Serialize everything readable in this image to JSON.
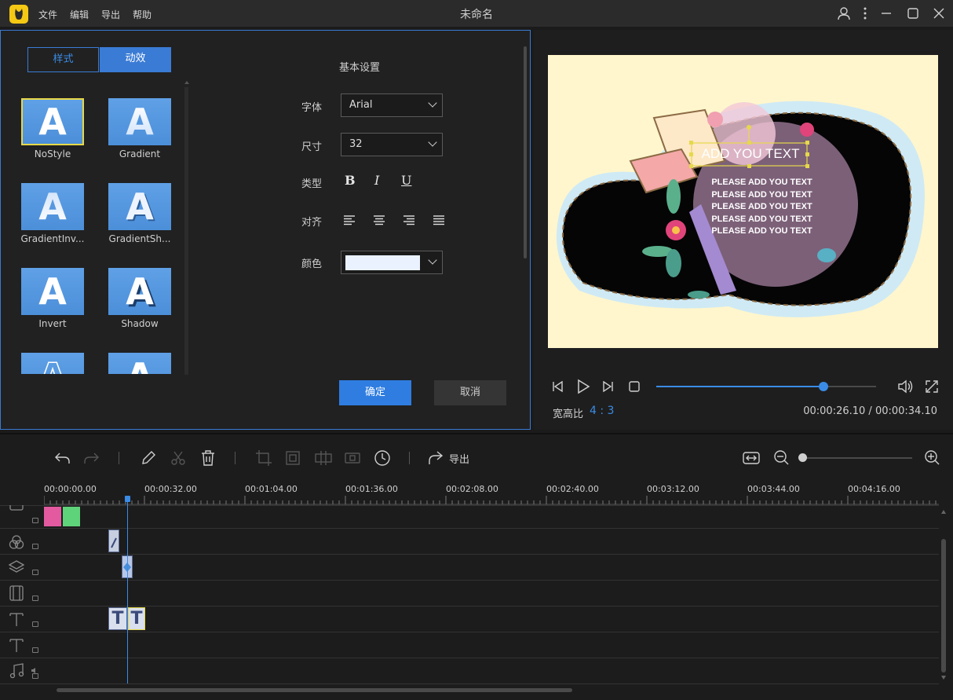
{
  "app": {
    "title": "未命名",
    "menu": [
      "文件",
      "编辑",
      "导出",
      "帮助"
    ]
  },
  "left_panel": {
    "tabs": [
      "样式",
      "动效"
    ],
    "styles": [
      {
        "glyph": "A",
        "label": "NoStyle"
      },
      {
        "glyph": "A",
        "label": "Gradient"
      },
      {
        "glyph": "A",
        "label": "GradientInv..."
      },
      {
        "glyph": "A",
        "label": "GradientSh..."
      },
      {
        "glyph": "A",
        "label": "Invert"
      },
      {
        "glyph": "A",
        "label": "Shadow"
      },
      {
        "glyph": "A",
        "label": ""
      },
      {
        "glyph": "A",
        "label": ""
      }
    ],
    "settings": {
      "heading": "基本设置",
      "font_label": "字体",
      "font_value": "Arial",
      "size_label": "尺寸",
      "size_value": "32",
      "type_label": "类型",
      "bold": "B",
      "italic": "I",
      "underline": "U",
      "align_label": "对齐",
      "color_label": "颜色",
      "color_value": "#eaf2ff"
    },
    "confirm_label": "确定",
    "cancel_label": "取消"
  },
  "preview": {
    "title_text": "ADD YOU TEXT",
    "body_lines": [
      "PLEASE ADD YOU TEXT",
      "PLEASE ADD YOU TEXT",
      "PLEASE ADD YOU TEXT",
      "PLEASE ADD YOU TEXT",
      "PLEASE ADD YOU TEXT"
    ],
    "aspect_label": "宽高比",
    "aspect_value": "4 : 3",
    "time": "00:00:26.10 / 00:00:34.10",
    "progress": 0.76
  },
  "timeline": {
    "export_label": "导出",
    "ticks": [
      "00:00:00.00",
      "00:00:32.00",
      "00:01:04.00",
      "00:01:36.00",
      "00:02:08.00",
      "00:02:40.00",
      "00:03:12.00",
      "00:03:44.00",
      "00:04:16.00"
    ],
    "clip_t": "T"
  },
  "colors": {
    "accent": "#3a7bd5",
    "bg": "#1b1b1b",
    "canvas": "#fff6cd"
  }
}
